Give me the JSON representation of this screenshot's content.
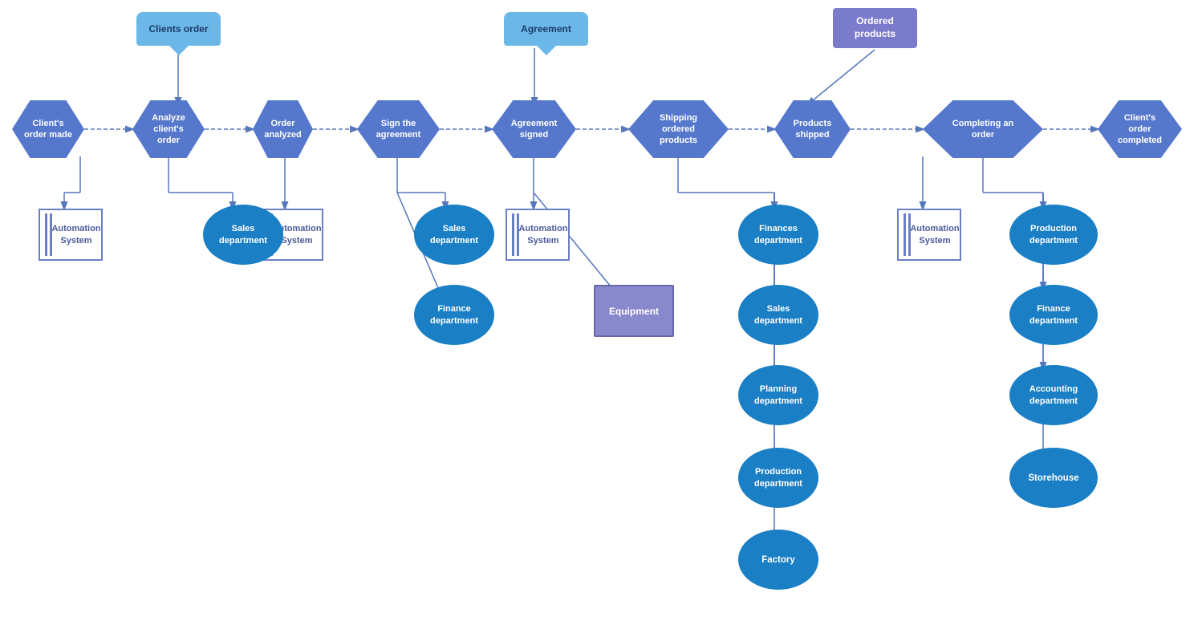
{
  "nodes": {
    "client_order_made": {
      "label": "Client's\norder made"
    },
    "analyze_client": {
      "label": "Analyze client's\norder"
    },
    "order_analyzed": {
      "label": "Order\nanalyzed"
    },
    "sign_agreement": {
      "label": "Sign the\nagreement"
    },
    "agreement_signed": {
      "label": "Agreement\nsigned"
    },
    "shipping_ordered": {
      "label": "Shipping\nordered\nproducts"
    },
    "products_shipped": {
      "label": "Products\nshipped"
    },
    "completing_order": {
      "label": "Completing an\norder"
    },
    "client_order_completed": {
      "label": "Client's\norder\ncompleted"
    },
    "clients_order_banner": {
      "label": "Clients order"
    },
    "agreement_banner": {
      "label": "Agreement"
    },
    "ordered_products_banner": {
      "label": "Ordered\nproducts"
    },
    "auto1": {
      "label": "Automation\nSystem"
    },
    "auto2": {
      "label": "Automation\nSystem"
    },
    "auto3": {
      "label": "Automation\nSystem"
    },
    "auto4": {
      "label": "Automation\nSystem"
    },
    "sales_dept1": {
      "label": "Sales\ndepartment"
    },
    "sales_dept2": {
      "label": "Sales\ndepartment"
    },
    "finance_dept1": {
      "label": "Finance\ndepartment"
    },
    "finances_dept": {
      "label": "Finances\ndepartment"
    },
    "equipment": {
      "label": "Equipment"
    },
    "production_dept1": {
      "label": "Production\ndepartment"
    },
    "finance_dept2": {
      "label": "Finance\ndepartment"
    },
    "accounting_dept": {
      "label": "Accounting\ndepartment"
    },
    "storehouse": {
      "label": "Storehouse"
    },
    "planning_dept": {
      "label": "Planning\ndepartment"
    },
    "production_dept2": {
      "label": "Production\ndepartment"
    },
    "factory": {
      "label": "Factory"
    }
  }
}
